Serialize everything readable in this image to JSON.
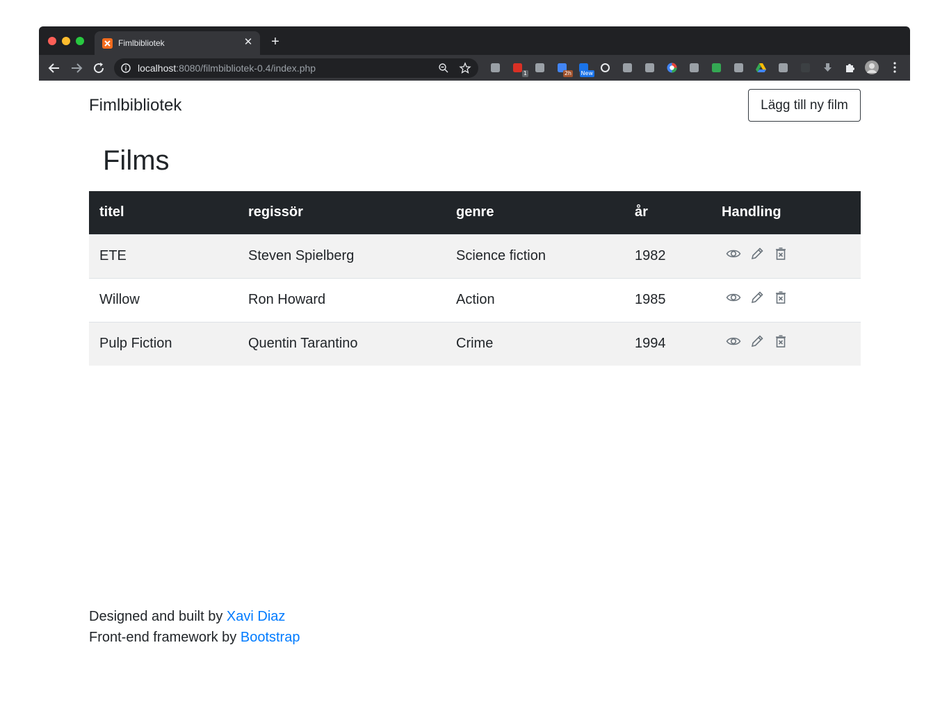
{
  "browser": {
    "tab_title": "Fimlbibliotek",
    "favicon_text": "ꟹ",
    "url_host": "localhost",
    "url_rest": ":8080/filmbibliotek-0.4/index.php",
    "extensions": [
      {
        "icon": "drive-icon",
        "color": "#9aa0a6"
      },
      {
        "icon": "calendar-red-icon",
        "color": "#d93025",
        "badge": "1",
        "badge_color": "#5f6368"
      },
      {
        "icon": "bulb-icon",
        "color": "#9aa0a6"
      },
      {
        "icon": "calendar-icon",
        "color": "#4285f4",
        "badge": "2h",
        "badge_color": "#a0522d"
      },
      {
        "icon": "mail-icon",
        "color": "#1a73e8",
        "badge": "New",
        "badge_color": "#1a73e8"
      },
      {
        "icon": "circle-icon",
        "color": "#e8eaed"
      },
      {
        "icon": "camera-icon",
        "color": "#9aa0a6"
      },
      {
        "icon": "print-icon",
        "color": "#9aa0a6"
      },
      {
        "icon": "color-wheel-icon",
        "color": "#ea4335"
      },
      {
        "icon": "feedly-icon",
        "color": "#9aa0a6"
      },
      {
        "icon": "stats-icon",
        "color": "#34a853"
      },
      {
        "icon": "download-circle-icon",
        "color": "#9aa0a6"
      },
      {
        "icon": "gdrive-icon",
        "color": "#fbbc04"
      },
      {
        "icon": "key-icon",
        "color": "#9aa0a6"
      },
      {
        "icon": "cloud-icon",
        "color": "#3c4043"
      },
      {
        "icon": "download-arrow-icon",
        "color": "#9aa0a6"
      },
      {
        "icon": "puzzle-icon",
        "color": "#e8eaed"
      },
      {
        "icon": "avatar",
        "color": "#bdbdbd"
      }
    ]
  },
  "navbar": {
    "brand": "Fimlbibliotek",
    "add_button": "Lägg till ny film"
  },
  "main": {
    "heading": "Films",
    "table": {
      "headers": [
        "titel",
        "regissör",
        "genre",
        "år",
        "Handling"
      ],
      "rows": [
        {
          "titel": "ETE",
          "regissor": "Steven Spielberg",
          "genre": "Science fiction",
          "ar": "1982"
        },
        {
          "titel": "Willow",
          "regissor": "Ron Howard",
          "genre": "Action",
          "ar": "1985"
        },
        {
          "titel": "Pulp Fiction",
          "regissor": "Quentin Tarantino",
          "genre": "Crime",
          "ar": "1994"
        }
      ],
      "action_icons": [
        "eye-icon",
        "pencil-icon",
        "trash-icon"
      ]
    }
  },
  "footer": {
    "line1_prefix": "Designed and built by ",
    "line1_link": "Xavi Diaz",
    "line2_prefix": "Front-end framework by ",
    "line2_link": "Bootstrap"
  },
  "colors": {
    "table_header_bg": "#212529",
    "stripe": "#f2f2f2",
    "link": "#007bff"
  }
}
